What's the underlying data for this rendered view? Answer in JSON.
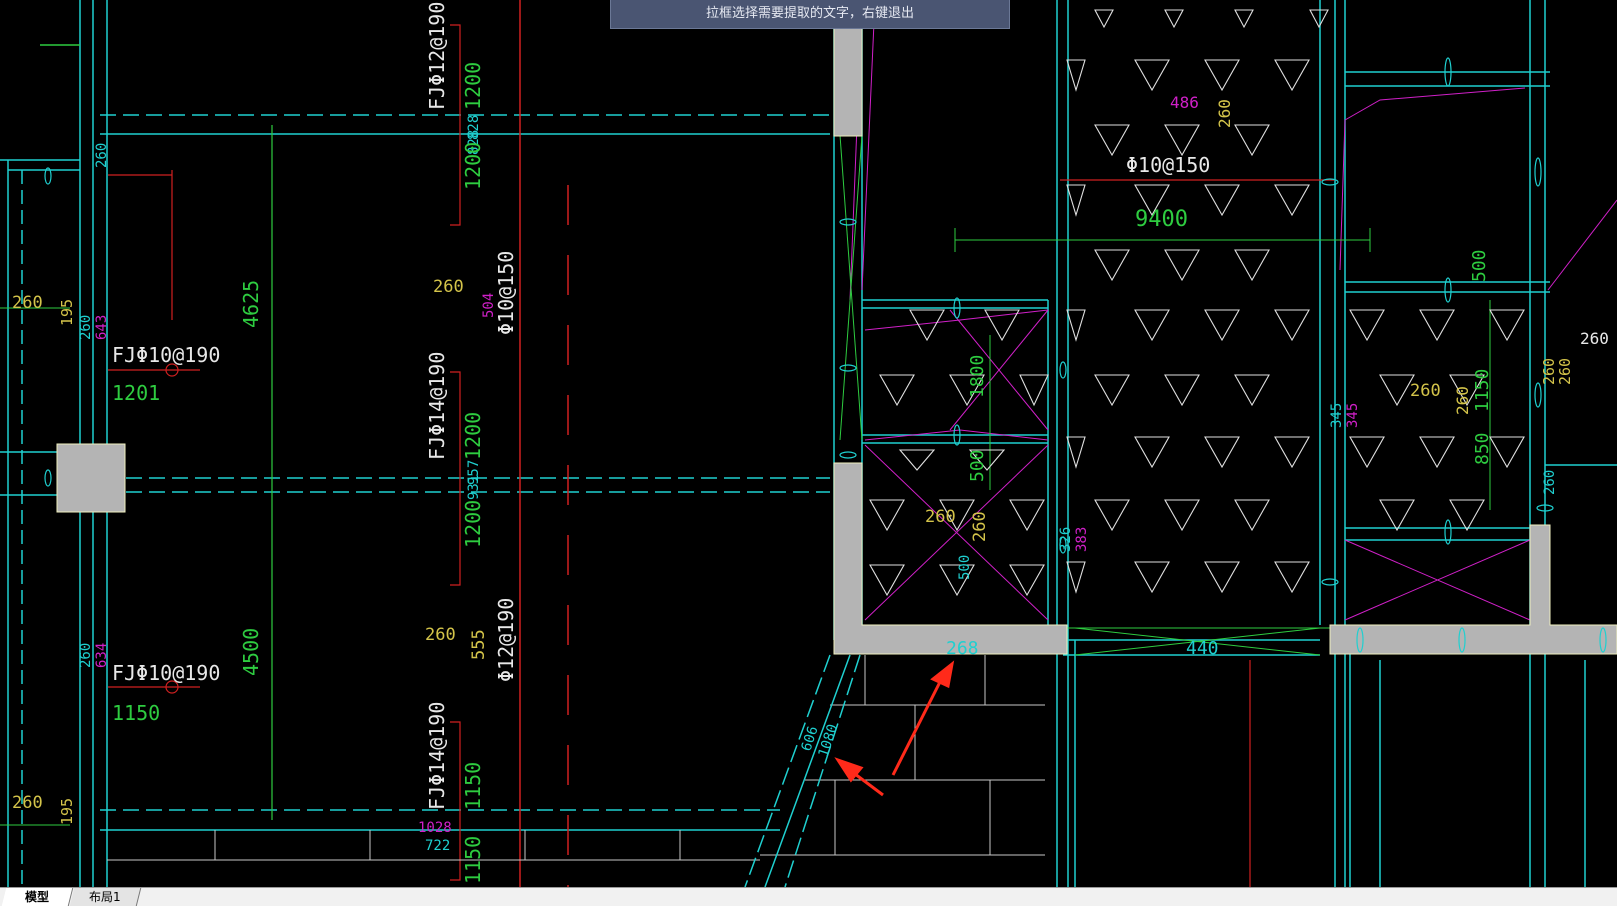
{
  "prompt": {
    "text": "拉框选择需要提取的文字，右键退出"
  },
  "tabs": [
    {
      "label": "模型",
      "active": true
    },
    {
      "label": "布局1",
      "active": false
    }
  ],
  "colors": {
    "background": "#000000",
    "cyan": "#1fd0d0",
    "green": "#2ecc40",
    "yellow": "#d4c44a",
    "magenta": "#d020c8",
    "red": "#d02020",
    "white": "#e8e8e8",
    "gray_fill": "#b4b4b4",
    "arrow": "#ff2a1a"
  },
  "labels": {
    "v_fj12_190": "FJΦ12@190",
    "v_1200_a": "1200",
    "v_828_a": "828",
    "v_828_b": "828",
    "v_1200_b": "1200",
    "v_260_left": "260",
    "v_4625": "4625",
    "v_260_mid": "260",
    "v_504": "504",
    "v_phi10_150_v": "Φ10@150",
    "h_fj10_190_a": "FJΦ10@190",
    "h_1201": "1201",
    "v_fj14_190_a": "FJΦ14@190",
    "v_1200_c": "1200",
    "v_957": "957",
    "v_931": "931",
    "v_1200_d": "1200",
    "v_4500": "4500",
    "v_260_b": "260",
    "v_555": "555",
    "v_phi12_190": "Φ12@190",
    "h_fj10_190_b": "FJΦ10@190",
    "h_1150": "1150",
    "v_fj14_190_b": "FJΦ14@190",
    "v_1150_a": "1150",
    "v_1028": "1028",
    "v_722": "722",
    "v_1150_b": "1150",
    "l_260_a": "260",
    "l_195_a": "195",
    "l_260_b": "260",
    "l_643": "643",
    "l_260_c": "260",
    "l_634": "634",
    "l_260_d": "260",
    "l_195_b": "195",
    "h_486": "486",
    "v_260_top": "260",
    "h_phi10_150": "Φ10@150",
    "h_9400": "9400",
    "v_1800": "1800",
    "v_500_a": "500",
    "h_260_c": "260",
    "v_260_c": "260",
    "v_326": "326",
    "v_383": "383",
    "v_500_b": "500",
    "v_345_a": "345",
    "v_345_b": "345",
    "h_260_r": "260",
    "v_260_r": "260",
    "v_1150_r": "1150",
    "v_850": "850",
    "v_260_r2": "260",
    "v_260_r3": "260",
    "h_260_far": "260",
    "v_260_far": "260",
    "v_500_r": "500",
    "h_268": "268",
    "h_440": "440",
    "d_606": "606",
    "d_1080": "1080"
  }
}
